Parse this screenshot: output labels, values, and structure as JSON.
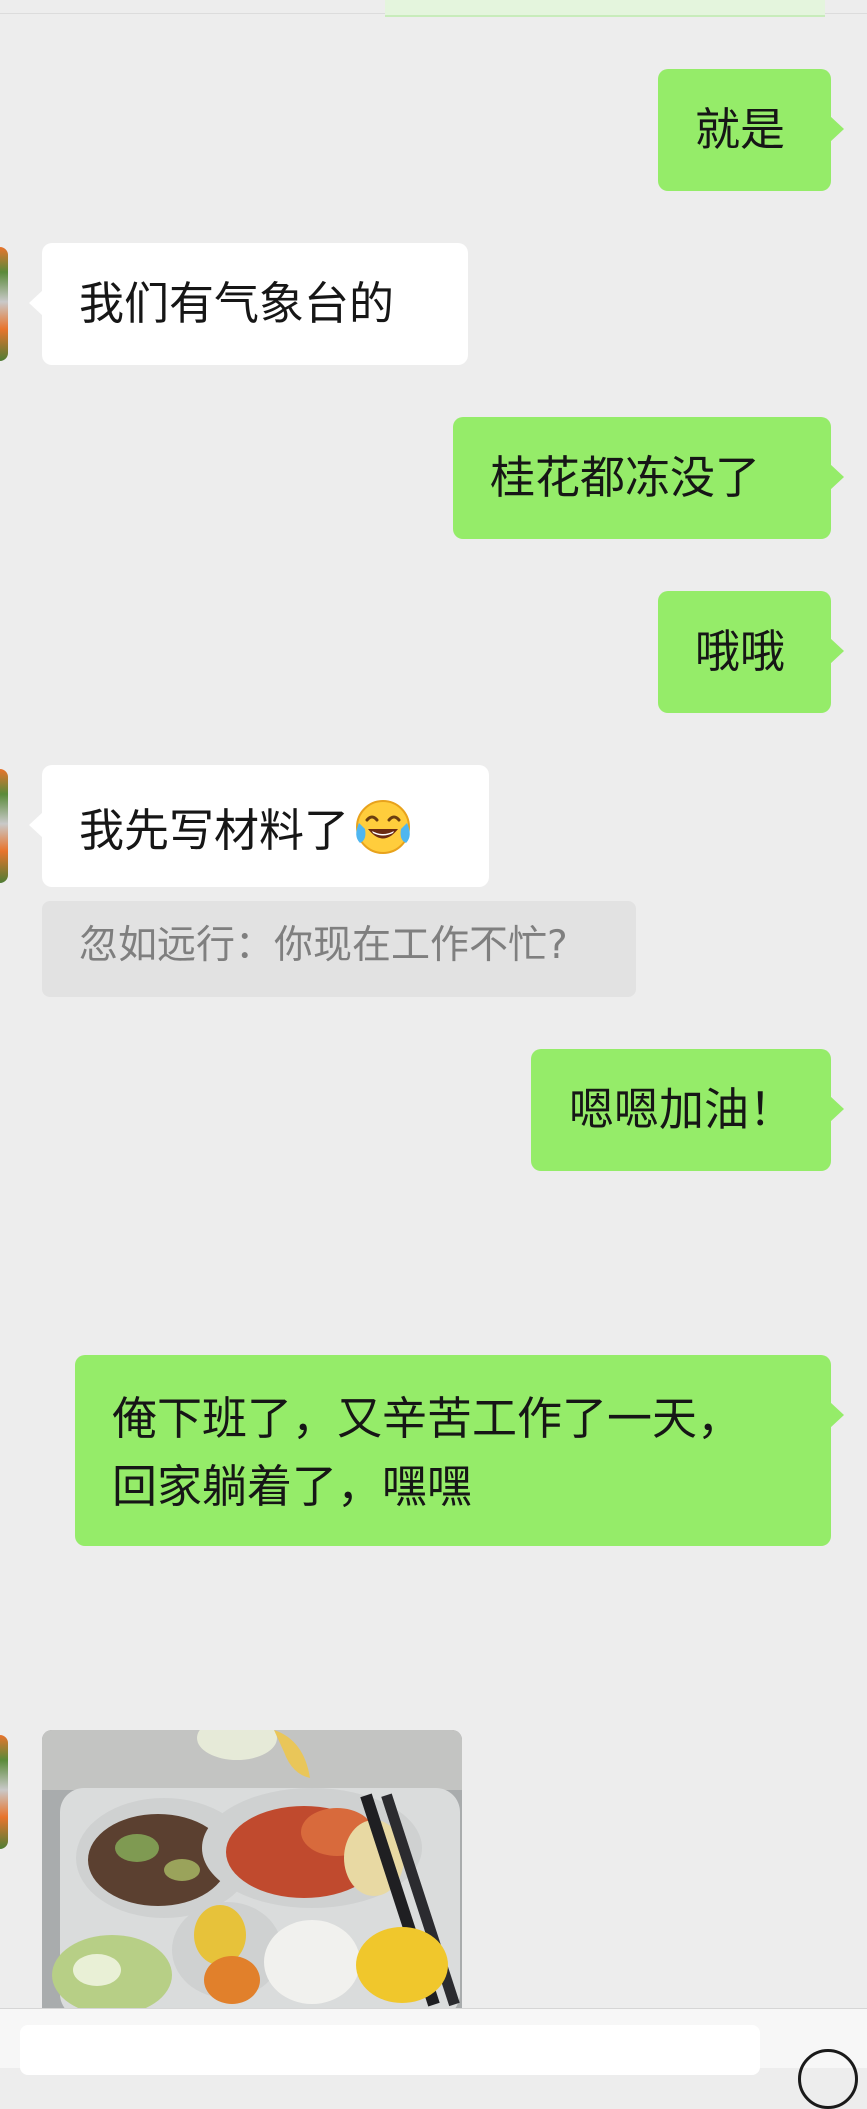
{
  "chat": {
    "messages": [
      {
        "from": "me",
        "text": "就是"
      },
      {
        "from": "other",
        "text": "我们有气象台的"
      },
      {
        "from": "me",
        "text": "桂花都冻没了"
      },
      {
        "from": "me",
        "text": "哦哦"
      },
      {
        "from": "other",
        "text": "我先写材料了",
        "emoji": "tears-of-joy-emoji"
      },
      {
        "from": "me",
        "text": "嗯嗯加油！"
      },
      {
        "from": "me",
        "lines": [
          "俺下班了，又辛苦工作了一天，",
          "回家躺着了，嘿嘿"
        ]
      },
      {
        "from": "other",
        "type": "image",
        "image": "food-tray-photo"
      }
    ],
    "quote": {
      "text": "忽如远行：你现在工作不忙?"
    }
  },
  "colors": {
    "background": "#ededed",
    "sent_bubble": "#95ec69",
    "received_bubble": "#ffffff",
    "quote_background": "#e2e2e2",
    "quote_text": "#7f7f7f"
  },
  "input_bar": {
    "icon": "circle-button-icon"
  }
}
